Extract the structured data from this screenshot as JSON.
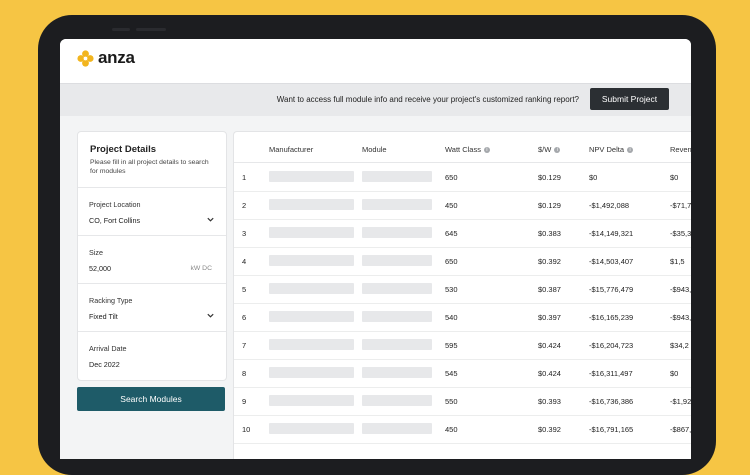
{
  "colors": {
    "background": "#f6c544",
    "accent": "#1e5b68",
    "submit": "#2b2f33",
    "logo": "#f2b51e"
  },
  "logo": {
    "text": "anza",
    "icon": "flower-logo-icon"
  },
  "banner": {
    "text": "Want to access full module info and receive your project's customized ranking report?",
    "submit_label": "Submit Project"
  },
  "sidebar": {
    "title": "Project Details",
    "subtitle": "Please fill in all project details to search for modules",
    "fields": [
      {
        "label": "Project Location",
        "value": "CO, Fort Collins",
        "control": "dropdown"
      },
      {
        "label": "Size",
        "value": "52,000",
        "unit": "kW DC",
        "control": "input"
      },
      {
        "label": "Racking Type",
        "value": "Fixed Tilt",
        "control": "dropdown"
      },
      {
        "label": "Arrival Date",
        "value": "Dec 2022",
        "control": "input"
      }
    ],
    "search_label": "Search Modules"
  },
  "table": {
    "headers": {
      "manufacturer": "Manufacturer",
      "module": "Module",
      "watt_class": "Watt Class",
      "sw": "$/W",
      "npv": "NPV Delta",
      "revenue": "Reven"
    },
    "rows": [
      {
        "n": "1",
        "watt": "650",
        "sw": "$0.129",
        "npv": "$0",
        "rev": "$0"
      },
      {
        "n": "2",
        "watt": "450",
        "sw": "$0.129",
        "npv": "-$1,492,088",
        "rev": "-$71,7"
      },
      {
        "n": "3",
        "watt": "645",
        "sw": "$0.383",
        "npv": "-$14,149,321",
        "rev": "-$35,3"
      },
      {
        "n": "4",
        "watt": "650",
        "sw": "$0.392",
        "npv": "-$14,503,407",
        "rev": "$1,5"
      },
      {
        "n": "5",
        "watt": "530",
        "sw": "$0.387",
        "npv": "-$15,776,479",
        "rev": "-$943,"
      },
      {
        "n": "6",
        "watt": "540",
        "sw": "$0.397",
        "npv": "-$16,165,239",
        "rev": "-$943,"
      },
      {
        "n": "7",
        "watt": "595",
        "sw": "$0.424",
        "npv": "-$16,204,723",
        "rev": "$34,2"
      },
      {
        "n": "8",
        "watt": "545",
        "sw": "$0.424",
        "npv": "-$16,311,497",
        "rev": "$0"
      },
      {
        "n": "9",
        "watt": "550",
        "sw": "$0.393",
        "npv": "-$16,736,386",
        "rev": "-$1,92"
      },
      {
        "n": "10",
        "watt": "450",
        "sw": "$0.392",
        "npv": "-$16,791,165",
        "rev": "-$867,3"
      }
    ]
  }
}
